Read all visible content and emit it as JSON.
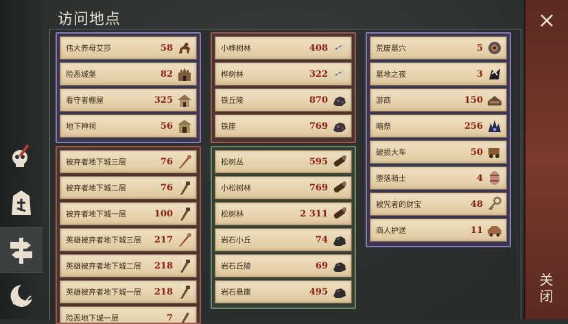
{
  "header": {
    "title": "访问地点"
  },
  "close": {
    "label": "关闭"
  },
  "groups": {
    "purple_top": [
      {
        "name": "伟大养母艾莎",
        "count": "58",
        "icon": "horse-icon"
      },
      {
        "name": "险恶城堡",
        "count": "82",
        "icon": "castle-icon"
      },
      {
        "name": "看守者棚屋",
        "count": "325",
        "icon": "hut-icon"
      },
      {
        "name": "地下神祠",
        "count": "56",
        "icon": "shrine-icon"
      }
    ],
    "red_left": [
      {
        "name": "被弃者地下城三层",
        "count": "76",
        "icon": "dungeon-key-icon"
      },
      {
        "name": "被弃者地下城二层",
        "count": "76",
        "icon": "dungeon-key-icon"
      },
      {
        "name": "被弃者地下城一层",
        "count": "100",
        "icon": "dungeon-key-icon"
      },
      {
        "name": "英雄被弃者地下城三层",
        "count": "217",
        "icon": "dungeon-key-icon"
      },
      {
        "name": "英雄被弃者地下城二层",
        "count": "218",
        "icon": "dungeon-key-icon"
      },
      {
        "name": "英雄被弃者地下城一层",
        "count": "218",
        "icon": "dungeon-key-icon"
      },
      {
        "name": "险恶地下城一层",
        "count": "7",
        "icon": "dungeon-key-icon"
      }
    ],
    "red_mid": [
      {
        "name": "小桦树林",
        "count": "408",
        "icon": "birch-log-icon"
      },
      {
        "name": "桦树林",
        "count": "322",
        "icon": "birch-log-icon"
      },
      {
        "name": "铁丘陵",
        "count": "870",
        "icon": "iron-ore-icon"
      },
      {
        "name": "铁崖",
        "count": "769",
        "icon": "iron-ore-icon"
      }
    ],
    "green_mid": [
      {
        "name": "松树丛",
        "count": "595",
        "icon": "pine-log-icon"
      },
      {
        "name": "小松树林",
        "count": "769",
        "icon": "pine-log-icon"
      },
      {
        "name": "松树林",
        "count": "2 311",
        "icon": "pine-log-icon"
      },
      {
        "name": "岩石小丘",
        "count": "74",
        "icon": "stone-icon"
      },
      {
        "name": "岩石丘陵",
        "count": "69",
        "icon": "stone-icon"
      },
      {
        "name": "岩石悬崖",
        "count": "495",
        "icon": "stone-icon"
      }
    ],
    "purple_right": [
      {
        "name": "荒废墓穴",
        "count": "5",
        "icon": "crypt-icon"
      },
      {
        "name": "墓地之夜",
        "count": "3",
        "icon": "graveyard-icon"
      },
      {
        "name": "游商",
        "count": "150",
        "icon": "merchant-icon"
      },
      {
        "name": "暗祭",
        "count": "256",
        "icon": "dark-ritual-icon"
      },
      {
        "name": "破损大车",
        "count": "50",
        "icon": "cart-icon"
      },
      {
        "name": "堕落骑士",
        "count": "4",
        "icon": "barrel-icon"
      },
      {
        "name": "被咒者的财宝",
        "count": "48",
        "icon": "key-icon"
      },
      {
        "name": "商人护送",
        "count": "11",
        "icon": "caravan-icon"
      }
    ]
  },
  "colors": {
    "purple_border": "#8b79b8",
    "red_border": "#9a5a4c",
    "green_border": "#6a8a6a",
    "count_text": "#8c1c12"
  }
}
